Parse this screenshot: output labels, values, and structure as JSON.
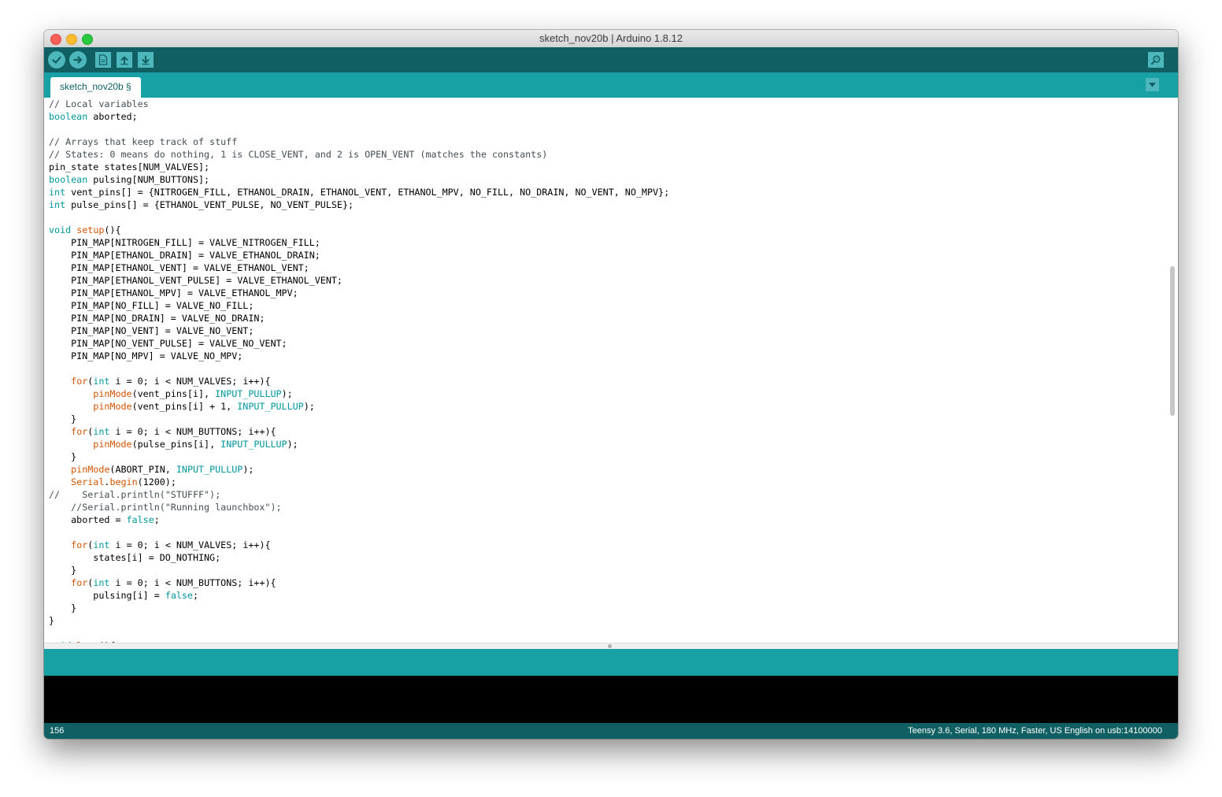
{
  "window": {
    "title": "sketch_nov20b | Arduino 1.8.12"
  },
  "toolbar": {
    "buttons": [
      {
        "name": "verify",
        "icon": "checkmark-icon"
      },
      {
        "name": "upload",
        "icon": "arrow-right-icon"
      },
      {
        "name": "new",
        "icon": "new-file-icon"
      },
      {
        "name": "open",
        "icon": "arrow-up-icon"
      },
      {
        "name": "save",
        "icon": "arrow-down-icon"
      },
      {
        "name": "serial-monitor",
        "icon": "magnifier-icon"
      }
    ]
  },
  "tabs": [
    {
      "label": "sketch_nov20b §",
      "active": true
    }
  ],
  "editor": {
    "lines": [
      [
        {
          "t": "// Local variables",
          "c": "cm"
        }
      ],
      [
        {
          "t": "boolean",
          "c": "kw"
        },
        {
          "t": " aborted;"
        }
      ],
      [],
      [
        {
          "t": "// Arrays that keep track of stuff",
          "c": "cm"
        }
      ],
      [
        {
          "t": "// States: 0 means do nothing, 1 is CLOSE_VENT, and 2 is OPEN_VENT (matches the constants)",
          "c": "cm"
        }
      ],
      [
        {
          "t": "pin_state states[NUM_VALVES];"
        }
      ],
      [
        {
          "t": "boolean",
          "c": "kw"
        },
        {
          "t": " pulsing[NUM_BUTTONS];"
        }
      ],
      [
        {
          "t": "int",
          "c": "kw"
        },
        {
          "t": " vent_pins[] = {NITROGEN_FILL, ETHANOL_DRAIN, ETHANOL_VENT, ETHANOL_MPV, NO_FILL, NO_DRAIN, NO_VENT, NO_MPV};"
        }
      ],
      [
        {
          "t": "int",
          "c": "kw"
        },
        {
          "t": " pulse_pins[] = {ETHANOL_VENT_PULSE, NO_VENT_PULSE};"
        }
      ],
      [],
      [
        {
          "t": "void",
          "c": "kw"
        },
        {
          "t": " "
        },
        {
          "t": "setup",
          "c": "fn"
        },
        {
          "t": "(){"
        }
      ],
      [
        {
          "t": "    PIN_MAP[NITROGEN_FILL] = VALVE_NITROGEN_FILL;"
        }
      ],
      [
        {
          "t": "    PIN_MAP[ETHANOL_DRAIN] = VALVE_ETHANOL_DRAIN;"
        }
      ],
      [
        {
          "t": "    PIN_MAP[ETHANOL_VENT] = VALVE_ETHANOL_VENT;"
        }
      ],
      [
        {
          "t": "    PIN_MAP[ETHANOL_VENT_PULSE] = VALVE_ETHANOL_VENT;"
        }
      ],
      [
        {
          "t": "    PIN_MAP[ETHANOL_MPV] = VALVE_ETHANOL_MPV;"
        }
      ],
      [
        {
          "t": "    PIN_MAP[NO_FILL] = VALVE_NO_FILL;"
        }
      ],
      [
        {
          "t": "    PIN_MAP[NO_DRAIN] = VALVE_NO_DRAIN;"
        }
      ],
      [
        {
          "t": "    PIN_MAP[NO_VENT] = VALVE_NO_VENT;"
        }
      ],
      [
        {
          "t": "    PIN_MAP[NO_VENT_PULSE] = VALVE_NO_VENT;"
        }
      ],
      [
        {
          "t": "    PIN_MAP[NO_MPV] = VALVE_NO_MPV;"
        }
      ],
      [],
      [
        {
          "t": "    "
        },
        {
          "t": "for",
          "c": "fn"
        },
        {
          "t": "("
        },
        {
          "t": "int",
          "c": "kw"
        },
        {
          "t": " i = 0; i < NUM_VALVES; i++){"
        }
      ],
      [
        {
          "t": "        "
        },
        {
          "t": "pinMode",
          "c": "fn"
        },
        {
          "t": "(vent_pins[i], "
        },
        {
          "t": "INPUT_PULLUP",
          "c": "lt"
        },
        {
          "t": ");"
        }
      ],
      [
        {
          "t": "        "
        },
        {
          "t": "pinMode",
          "c": "fn"
        },
        {
          "t": "(vent_pins[i] + 1, "
        },
        {
          "t": "INPUT_PULLUP",
          "c": "lt"
        },
        {
          "t": ");"
        }
      ],
      [
        {
          "t": "    }"
        }
      ],
      [
        {
          "t": "    "
        },
        {
          "t": "for",
          "c": "fn"
        },
        {
          "t": "("
        },
        {
          "t": "int",
          "c": "kw"
        },
        {
          "t": " i = 0; i < NUM_BUTTONS; i++){"
        }
      ],
      [
        {
          "t": "        "
        },
        {
          "t": "pinMode",
          "c": "fn"
        },
        {
          "t": "(pulse_pins[i], "
        },
        {
          "t": "INPUT_PULLUP",
          "c": "lt"
        },
        {
          "t": ");"
        }
      ],
      [
        {
          "t": "    }"
        }
      ],
      [
        {
          "t": "    "
        },
        {
          "t": "pinMode",
          "c": "fn"
        },
        {
          "t": "(ABORT_PIN, "
        },
        {
          "t": "INPUT_PULLUP",
          "c": "lt"
        },
        {
          "t": ");"
        }
      ],
      [
        {
          "t": "    "
        },
        {
          "t": "Serial",
          "c": "fn"
        },
        {
          "t": "."
        },
        {
          "t": "begin",
          "c": "fn"
        },
        {
          "t": "(1200);"
        }
      ],
      [
        {
          "t": "//    Serial.println(\"STUFFF\");",
          "c": "cm"
        }
      ],
      [
        {
          "t": "    //Serial.println(\"Running launchbox\");",
          "c": "cm"
        }
      ],
      [
        {
          "t": "    aborted = "
        },
        {
          "t": "false",
          "c": "lt"
        },
        {
          "t": ";"
        }
      ],
      [],
      [
        {
          "t": "    "
        },
        {
          "t": "for",
          "c": "fn"
        },
        {
          "t": "("
        },
        {
          "t": "int",
          "c": "kw"
        },
        {
          "t": " i = 0; i < NUM_VALVES; i++){"
        }
      ],
      [
        {
          "t": "        states[i] = DO_NOTHING;"
        }
      ],
      [
        {
          "t": "    }"
        }
      ],
      [
        {
          "t": "    "
        },
        {
          "t": "for",
          "c": "fn"
        },
        {
          "t": "("
        },
        {
          "t": "int",
          "c": "kw"
        },
        {
          "t": " i = 0; i < NUM_BUTTONS; i++){"
        }
      ],
      [
        {
          "t": "        pulsing[i] = "
        },
        {
          "t": "false",
          "c": "lt"
        },
        {
          "t": ";"
        }
      ],
      [
        {
          "t": "    }"
        }
      ],
      [
        {
          "t": "}"
        }
      ],
      [],
      [
        {
          "t": "void",
          "c": "kw"
        },
        {
          "t": " "
        },
        {
          "t": "loop",
          "c": "fn"
        },
        {
          "t": "(){"
        }
      ]
    ]
  },
  "status": {
    "line_number": "156",
    "board_info": "Teensy 3.6, Serial, 180 MHz, Faster, US English on usb:14100000"
  },
  "colors": {
    "toolbar": "#0f5f63",
    "tabbar": "#17a1a5",
    "button": "#4db7bb",
    "keyword": "#00979c",
    "function": "#d35400",
    "comment": "#434f54"
  }
}
